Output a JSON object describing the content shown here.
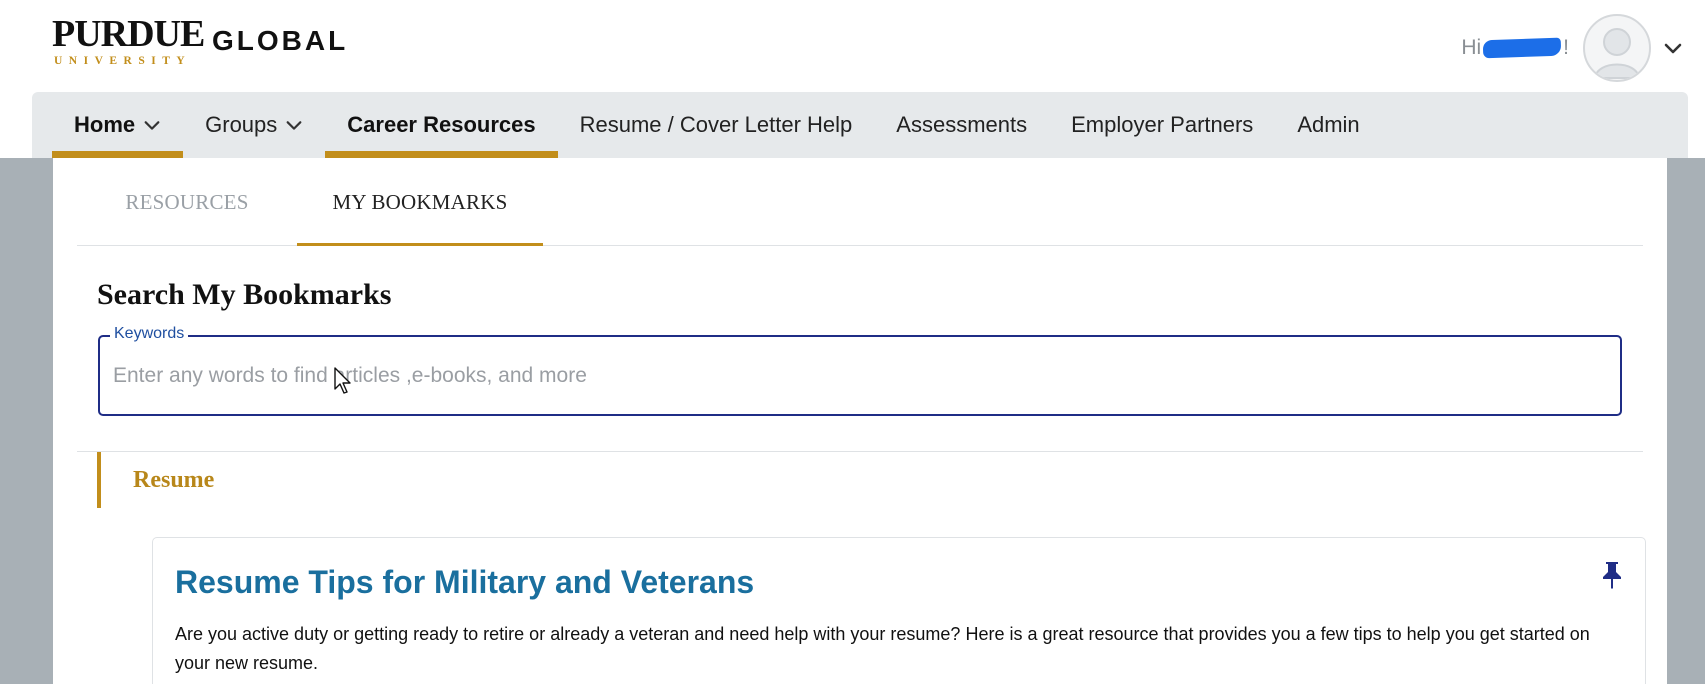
{
  "header": {
    "logo": {
      "line1": "PURDUE",
      "line2": "UNIVERSITY",
      "line3": "GLOBAL"
    },
    "greeting_prefix": "Hi",
    "greeting_suffix": "!",
    "avatar_icon": "user-avatar-icon",
    "menu_icon": "chevron-down-icon"
  },
  "nav": {
    "items": [
      {
        "label": "Home",
        "has_dropdown": true
      },
      {
        "label": "Groups",
        "has_dropdown": true
      },
      {
        "label": "Career Resources",
        "has_dropdown": false
      },
      {
        "label": "Resume / Cover Letter Help",
        "has_dropdown": false
      },
      {
        "label": "Assessments",
        "has_dropdown": false
      },
      {
        "label": "Employer Partners",
        "has_dropdown": false
      },
      {
        "label": "Admin",
        "has_dropdown": false
      }
    ]
  },
  "tabs": [
    {
      "label": "RESOURCES",
      "active": false
    },
    {
      "label": "MY BOOKMARKS",
      "active": true
    }
  ],
  "search": {
    "heading": "Search My Bookmarks",
    "label": "Keywords",
    "value": "",
    "placeholder": "Enter any words to find articles ,e-books, and more"
  },
  "section": {
    "title": "Resume"
  },
  "results": [
    {
      "title": "Resume Tips for Military and Veterans",
      "description": "Are you active duty or getting ready to retire or already a veteran and need help with your resume? Here is a great resource that provides you a few tips to help you get started on your new resume.",
      "pinned": true,
      "pin_icon": "pin-icon"
    }
  ],
  "colors": {
    "accent_gold": "#c28e1b",
    "nav_bg": "#e6e9eb",
    "field_border": "#1f2d86",
    "link_blue": "#1a6f9e",
    "backdrop": "#a8b0b6"
  }
}
